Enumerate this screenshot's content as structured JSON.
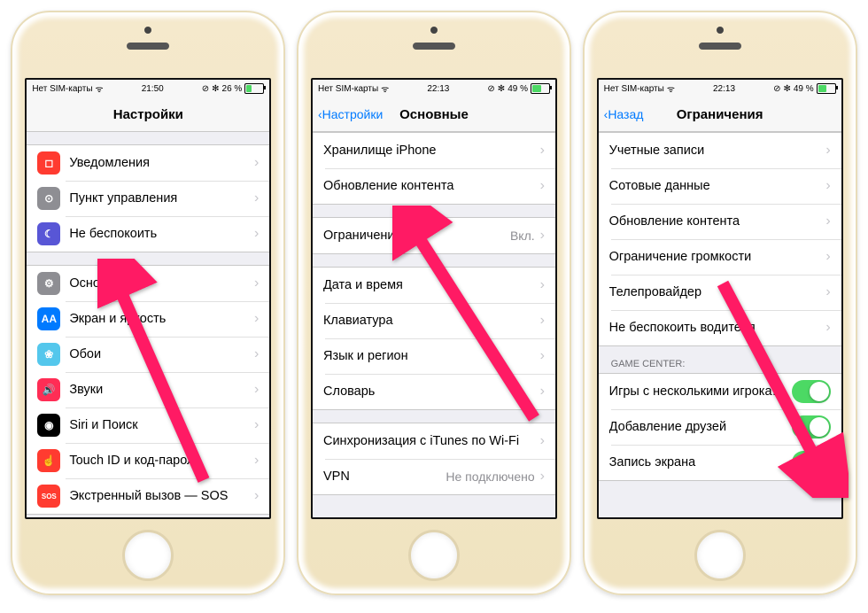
{
  "statusbar": {
    "carrier": "Нет SIM-карты",
    "time1": "21:50",
    "time2": "22:13",
    "time3": "22:13",
    "bt": "✻",
    "pct1": "26 %",
    "pct2": "49 %",
    "pct3": "49 %"
  },
  "screen1": {
    "title": "Настройки",
    "rows1": [
      {
        "label": "Уведомления",
        "icon": "#ff3b30",
        "glyph": "◻"
      },
      {
        "label": "Пункт управления",
        "icon": "#8e8e93",
        "glyph": "⊙"
      },
      {
        "label": "Не беспокоить",
        "icon": "#5856d6",
        "glyph": "☾"
      }
    ],
    "rows2": [
      {
        "label": "Основные",
        "icon": "#8e8e93",
        "glyph": "⚙"
      },
      {
        "label": "Экран и яркость",
        "icon": "#007aff",
        "glyph": "AA"
      },
      {
        "label": "Обои",
        "icon": "#54c7ec",
        "glyph": "❀"
      },
      {
        "label": "Звуки",
        "icon": "#ff2d55",
        "glyph": "🔊"
      },
      {
        "label": "Siri и Поиск",
        "icon": "#000",
        "glyph": "◉"
      },
      {
        "label": "Touch ID и код-пароль",
        "icon": "#ff3b30",
        "glyph": "☝"
      },
      {
        "label": "Экстренный вызов — SOS",
        "icon": "#ff3b30",
        "glyph": "SOS"
      }
    ]
  },
  "screen2": {
    "back": "Настройки",
    "title": "Основные",
    "rows1": [
      {
        "label": "Хранилище iPhone"
      },
      {
        "label": "Обновление контента"
      }
    ],
    "rows2": [
      {
        "label": "Ограничения",
        "detail": "Вкл."
      }
    ],
    "rows3": [
      {
        "label": "Дата и время"
      },
      {
        "label": "Клавиатура"
      },
      {
        "label": "Язык и регион"
      },
      {
        "label": "Словарь"
      }
    ],
    "rows4": [
      {
        "label": "Синхронизация с iTunes по Wi-Fi"
      },
      {
        "label": "VPN",
        "detail": "Не подключено"
      }
    ]
  },
  "screen3": {
    "back": "Назад",
    "title": "Ограничения",
    "rows1": [
      {
        "label": "Учетные записи"
      },
      {
        "label": "Сотовые данные"
      },
      {
        "label": "Обновление контента"
      },
      {
        "label": "Ограничение громкости"
      },
      {
        "label": "Телепровайдер"
      },
      {
        "label": "Не беспокоить водителя"
      }
    ],
    "section_header": "GAME CENTER:",
    "rows2": [
      {
        "label": "Игры с несколькими игрока…",
        "toggle": true
      },
      {
        "label": "Добавление друзей",
        "toggle": true
      },
      {
        "label": "Запись экрана",
        "toggle": true
      }
    ]
  }
}
